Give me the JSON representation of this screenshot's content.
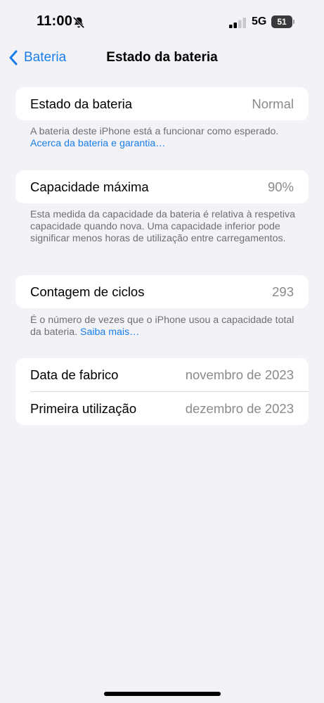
{
  "status_bar": {
    "time": "11:00",
    "network": "5G",
    "battery_level": "51"
  },
  "nav": {
    "back_label": "Bateria",
    "title": "Estado da bateria"
  },
  "health": {
    "label": "Estado da bateria",
    "value": "Normal",
    "footnote": "A bateria deste iPhone está a funcionar como esperado.",
    "footnote_link": "Acerca da bateria e garantia…"
  },
  "capacity": {
    "label": "Capacidade máxima",
    "value": "90%",
    "footnote": "Esta medida da capacidade da bateria é relativa à respetiva capacidade quando nova. Uma capacidade inferior pode significar menos horas de utilização entre carregamentos."
  },
  "cycles": {
    "label": "Contagem de ciclos",
    "value": "293",
    "footnote": "É o número de vezes que o iPhone usou a capacidade total da bateria.",
    "footnote_link": "Saiba mais…"
  },
  "dates": {
    "manufacture_label": "Data de fabrico",
    "manufacture_value": "novembro de 2023",
    "first_use_label": "Primeira utilização",
    "first_use_value": "dezembro de 2023"
  },
  "colors": {
    "background": "#f2f2f7",
    "accent": "#1a7ee8",
    "secondary_text": "#8a8a8e"
  }
}
